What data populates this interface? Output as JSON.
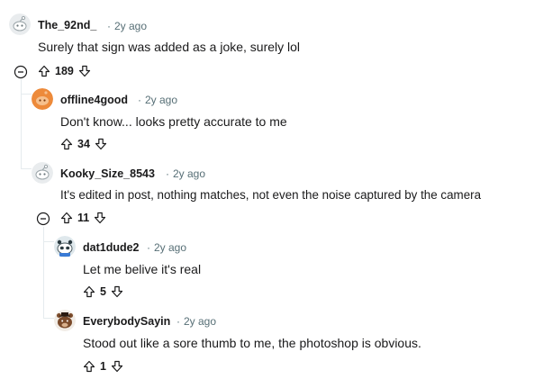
{
  "comments": [
    {
      "author": "The_92nd_",
      "separator": "·",
      "age": "2y ago",
      "text": "Surely that sign was added as a joke, surely lol",
      "score": "189",
      "avatar": "snoo-default-avatar"
    },
    {
      "author": "offline4good",
      "separator": "·",
      "age": "2y ago",
      "text": "Don't know... looks pretty accurate to me",
      "score": "34",
      "avatar": "orange-snoo-avatar"
    },
    {
      "author": "Kooky_Size_8543",
      "separator": "·",
      "age": "2y ago",
      "text": "It's edited in post, nothing matches, not even the noise captured by the camera",
      "score": "11",
      "avatar": "snoo-default-avatar"
    },
    {
      "author": "dat1dude2",
      "separator": "·",
      "age": "2y ago",
      "text": "Let me belive it's real",
      "score": "5",
      "avatar": "panda-snoo-avatar"
    },
    {
      "author": "EverybodySayin",
      "separator": "·",
      "age": "2y ago",
      "text": "Stood out like a sore thumb to me, the photoshop is obvious.",
      "score": "1",
      "avatar": "bear-snoo-avatar"
    }
  ],
  "icons": {
    "upvote": "upvote-arrow-icon",
    "downvote": "downvote-arrow-icon",
    "collapse": "collapse-minus-icon"
  },
  "colors": {
    "text": "#1a1a1b",
    "meta": "#576f76",
    "thread_line": "#e5ebee",
    "orange_avatar": "#ed8a3a"
  }
}
